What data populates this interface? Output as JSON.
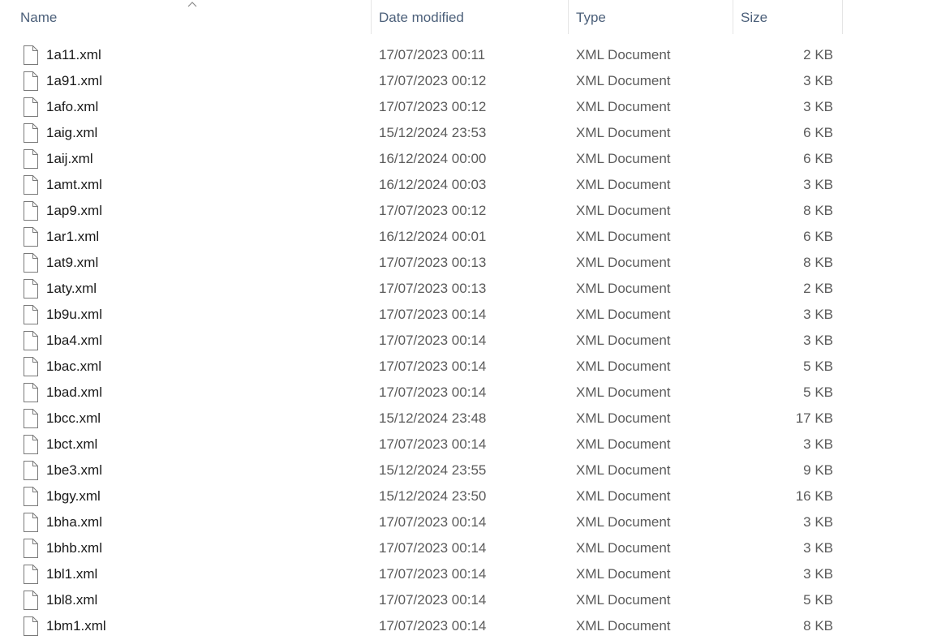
{
  "header": {
    "name_label": "Name",
    "date_label": "Date modified",
    "type_label": "Type",
    "size_label": "Size",
    "sort_icon": "chevron-up-icon"
  },
  "files": [
    {
      "name": "1a11.xml",
      "date": "17/07/2023 00:11",
      "type": "XML Document",
      "size": "2 KB"
    },
    {
      "name": "1a91.xml",
      "date": "17/07/2023 00:12",
      "type": "XML Document",
      "size": "3 KB"
    },
    {
      "name": "1afo.xml",
      "date": "17/07/2023 00:12",
      "type": "XML Document",
      "size": "3 KB"
    },
    {
      "name": "1aig.xml",
      "date": "15/12/2024 23:53",
      "type": "XML Document",
      "size": "6 KB"
    },
    {
      "name": "1aij.xml",
      "date": "16/12/2024 00:00",
      "type": "XML Document",
      "size": "6 KB"
    },
    {
      "name": "1amt.xml",
      "date": "16/12/2024 00:03",
      "type": "XML Document",
      "size": "3 KB"
    },
    {
      "name": "1ap9.xml",
      "date": "17/07/2023 00:12",
      "type": "XML Document",
      "size": "8 KB"
    },
    {
      "name": "1ar1.xml",
      "date": "16/12/2024 00:01",
      "type": "XML Document",
      "size": "6 KB"
    },
    {
      "name": "1at9.xml",
      "date": "17/07/2023 00:13",
      "type": "XML Document",
      "size": "8 KB"
    },
    {
      "name": "1aty.xml",
      "date": "17/07/2023 00:13",
      "type": "XML Document",
      "size": "2 KB"
    },
    {
      "name": "1b9u.xml",
      "date": "17/07/2023 00:14",
      "type": "XML Document",
      "size": "3 KB"
    },
    {
      "name": "1ba4.xml",
      "date": "17/07/2023 00:14",
      "type": "XML Document",
      "size": "3 KB"
    },
    {
      "name": "1bac.xml",
      "date": "17/07/2023 00:14",
      "type": "XML Document",
      "size": "5 KB"
    },
    {
      "name": "1bad.xml",
      "date": "17/07/2023 00:14",
      "type": "XML Document",
      "size": "5 KB"
    },
    {
      "name": "1bcc.xml",
      "date": "15/12/2024 23:48",
      "type": "XML Document",
      "size": "17 KB"
    },
    {
      "name": "1bct.xml",
      "date": "17/07/2023 00:14",
      "type": "XML Document",
      "size": "3 KB"
    },
    {
      "name": "1be3.xml",
      "date": "15/12/2024 23:55",
      "type": "XML Document",
      "size": "9 KB"
    },
    {
      "name": "1bgy.xml",
      "date": "15/12/2024 23:50",
      "type": "XML Document",
      "size": "16 KB"
    },
    {
      "name": "1bha.xml",
      "date": "17/07/2023 00:14",
      "type": "XML Document",
      "size": "3 KB"
    },
    {
      "name": "1bhb.xml",
      "date": "17/07/2023 00:14",
      "type": "XML Document",
      "size": "3 KB"
    },
    {
      "name": "1bl1.xml",
      "date": "17/07/2023 00:14",
      "type": "XML Document",
      "size": "3 KB"
    },
    {
      "name": "1bl8.xml",
      "date": "17/07/2023 00:14",
      "type": "XML Document",
      "size": "5 KB"
    },
    {
      "name": "1bm1.xml",
      "date": "17/07/2023 00:14",
      "type": "XML Document",
      "size": "8 KB"
    }
  ],
  "file_icon": "document-icon",
  "colors": {
    "header_text": "#4c607a",
    "cell_text": "#5b5b5b",
    "name_text": "#1a1a1a"
  }
}
